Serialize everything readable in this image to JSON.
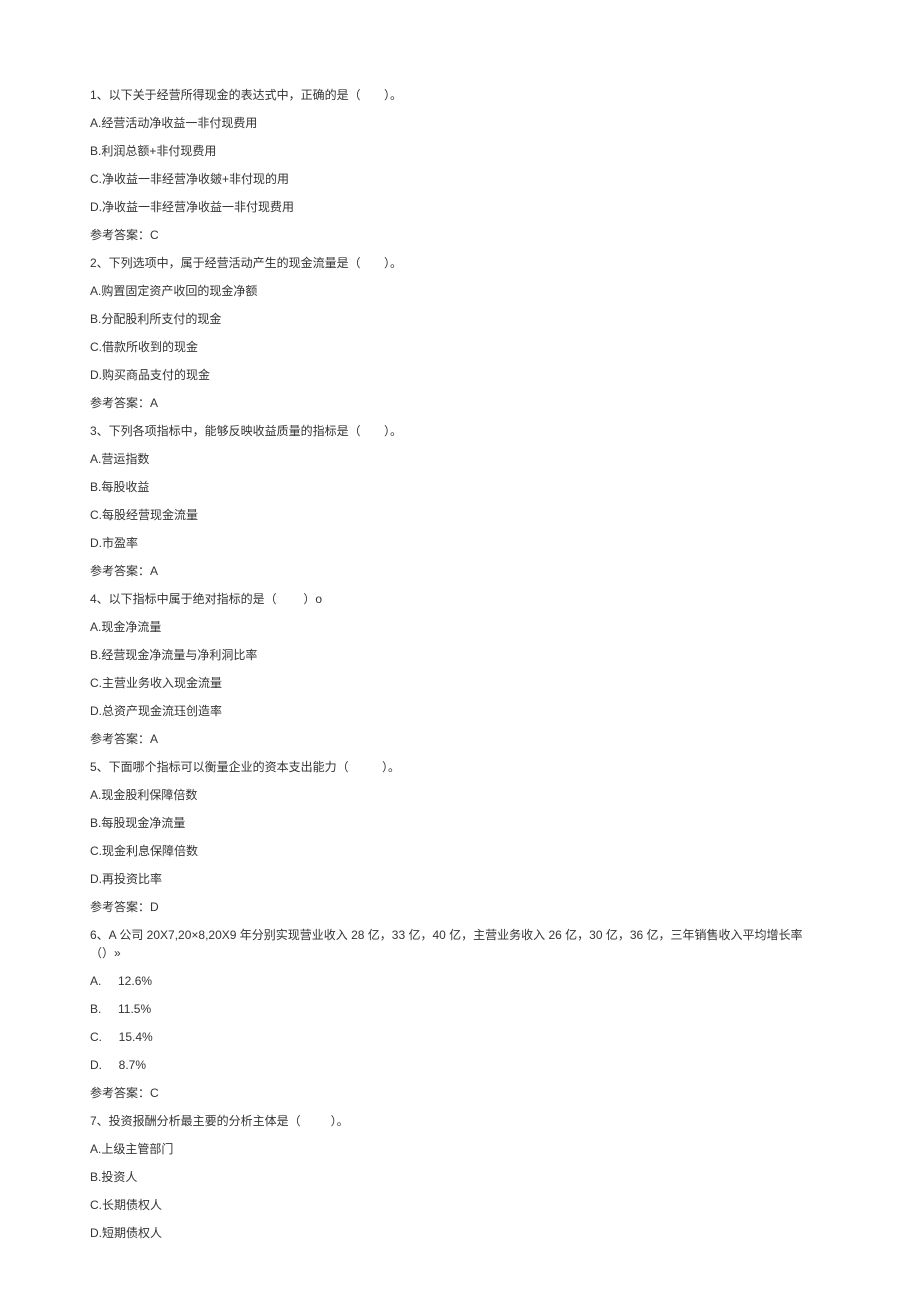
{
  "questions": [
    {
      "stem": "1、以下关于经营所得现金的表达式中，正确的是（       ）。",
      "options": [
        "A.经营活动净收益一非付现费用",
        "B.利润总额+非付现费用",
        "C.净收益一非经营净收皴+非付现的用",
        "D.净收益一非经营净收益一非付现费用"
      ],
      "answer": "参考答案：C"
    },
    {
      "stem": "2、下列选项中，属于经营活动产生的现金流量是（       ）。",
      "options": [
        "A.购置固定资产收回的现金净额",
        "B.分配股利所支付的现金",
        "C.借款所收到的现金",
        "D.购买商品支付的现金"
      ],
      "answer": "参考答案：A"
    },
    {
      "stem": "3、下列各项指标中，能够反映收益质量的指标是（       ）。",
      "options": [
        "A.营运指数",
        "B.每股收益",
        "C.每股经营现金流量",
        "D.市盈率"
      ],
      "answer": "参考答案：A"
    },
    {
      "stem": "4、以下指标中属于绝对指标的是（        ）o",
      "options": [
        "A.现金净流量",
        "B.经营现金净流量与净利洞比率",
        "C.主营业务收入现金流量",
        "D.总资产现金流珏创造率"
      ],
      "answer": "参考答案：A"
    },
    {
      "stem": "5、下面哪个指标可以衡量企业的资本支出能力（          ）。",
      "options": [
        "A.现金股利保障倍数",
        "B.每股现金净流量",
        "C.现金利息保障倍数",
        "D.再投资比率"
      ],
      "answer": "参考答案：D"
    },
    {
      "stem": "6、A 公司 20X7,20×8,20X9 年分别实现营业收入 28 亿，33 亿，40 亿，主营业务收入 26 亿，30 亿，36 亿，三年销售收入平均增长率（）»",
      "options": [
        "A.     12.6%",
        "B.     11.5%",
        "C.     15.4%",
        "D.     8.7%"
      ],
      "answer": "参考答案：C"
    },
    {
      "stem": "7、投资报酬分析最主要的分析主体是（         ）。",
      "options": [
        "A.上级主管部门",
        "B.投资人",
        "C.长期债权人",
        "D.短期债权人"
      ],
      "answer": ""
    }
  ]
}
